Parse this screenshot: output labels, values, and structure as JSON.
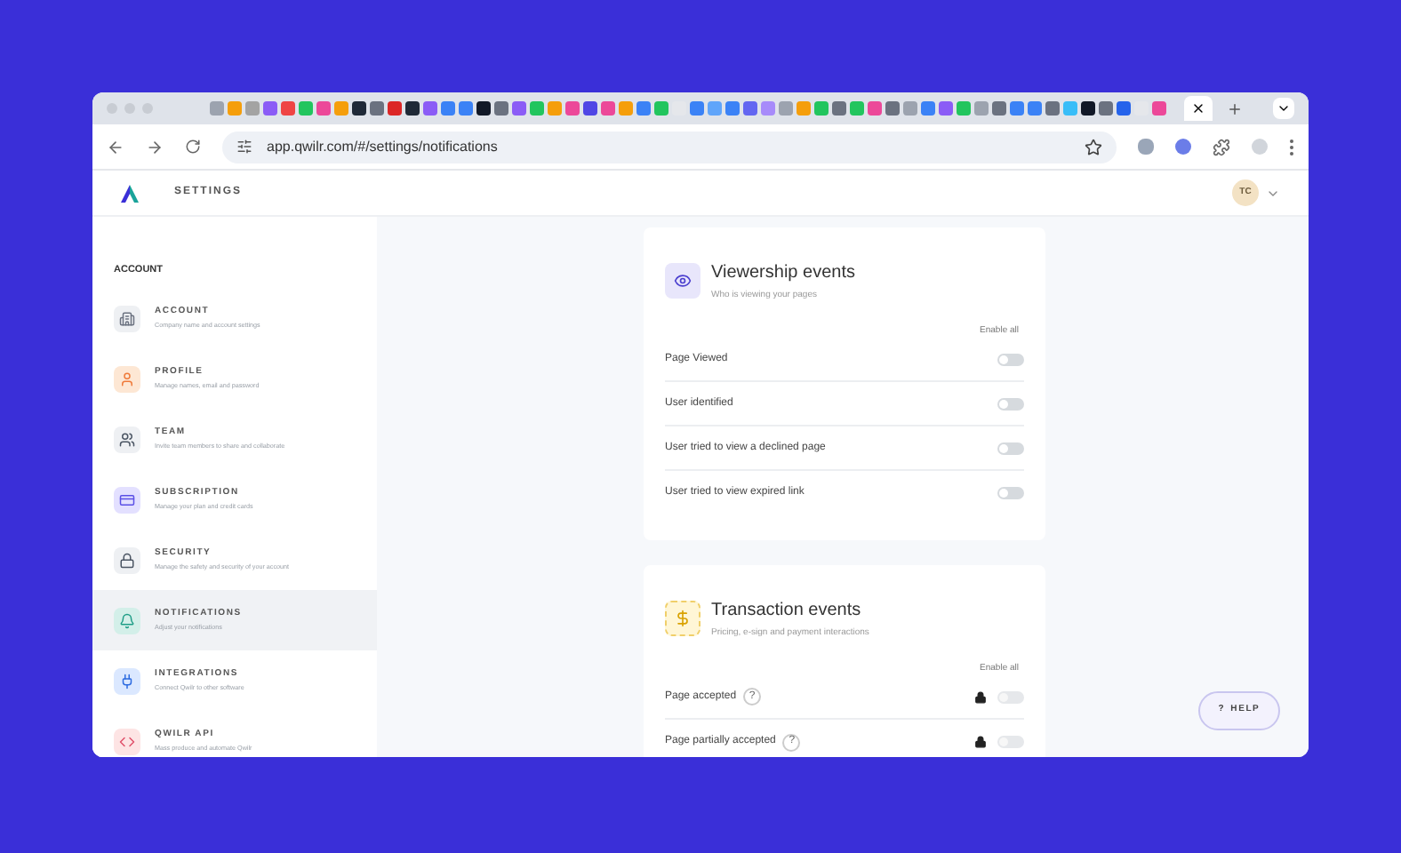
{
  "browser": {
    "url": "app.qwilr.com/#/settings/notifications"
  },
  "header": {
    "title": "SETTINGS",
    "avatar": "TC"
  },
  "sidebar": {
    "heading": "ACCOUNT",
    "items": [
      {
        "kind": "building",
        "label": "ACCOUNT",
        "description": "Company name and account settings",
        "selected": false
      },
      {
        "kind": "profile",
        "label": "PROFILE",
        "description": "Manage names, email and password",
        "selected": false
      },
      {
        "kind": "team",
        "label": "TEAM",
        "description": "Invite team members to share and collaborate",
        "selected": false
      },
      {
        "kind": "card",
        "label": "SUBSCRIPTION",
        "description": "Manage your plan and credit cards",
        "selected": false
      },
      {
        "kind": "lock",
        "label": "SECURITY",
        "description": "Manage the safety and security of your account",
        "selected": false
      },
      {
        "kind": "bell",
        "label": "NOTIFICATIONS",
        "description": "Adjust your notifications",
        "selected": true
      },
      {
        "kind": "plug",
        "label": "INTEGRATIONS",
        "description": "Connect Qwilr to other software",
        "selected": false
      },
      {
        "kind": "code",
        "label": "QWILR API",
        "description": "Mass produce and automate Qwilr",
        "selected": false
      }
    ]
  },
  "sections": [
    {
      "kind": "eye",
      "title": "Viewership events",
      "subtitle": "Who is viewing your pages",
      "enable_all": "Enable all",
      "rows": [
        {
          "label": "Page Viewed",
          "locked": false,
          "on": false
        },
        {
          "label": "User identified",
          "locked": false,
          "on": false
        },
        {
          "label": "User tried to view a declined page",
          "locked": false,
          "on": false
        },
        {
          "label": "User tried to view expired link",
          "locked": false,
          "on": false
        }
      ]
    },
    {
      "kind": "dollar",
      "title": "Transaction events",
      "subtitle": "Pricing, e-sign and payment interactions",
      "enable_all": "Enable all",
      "rows": [
        {
          "label": "Page accepted",
          "help_icon": "?",
          "locked": true,
          "on": false
        },
        {
          "label": "Page partially accepted",
          "help_icon": "?",
          "locked": true,
          "on": false
        }
      ]
    }
  ],
  "help_button": {
    "icon": "?",
    "label": "HELP"
  }
}
